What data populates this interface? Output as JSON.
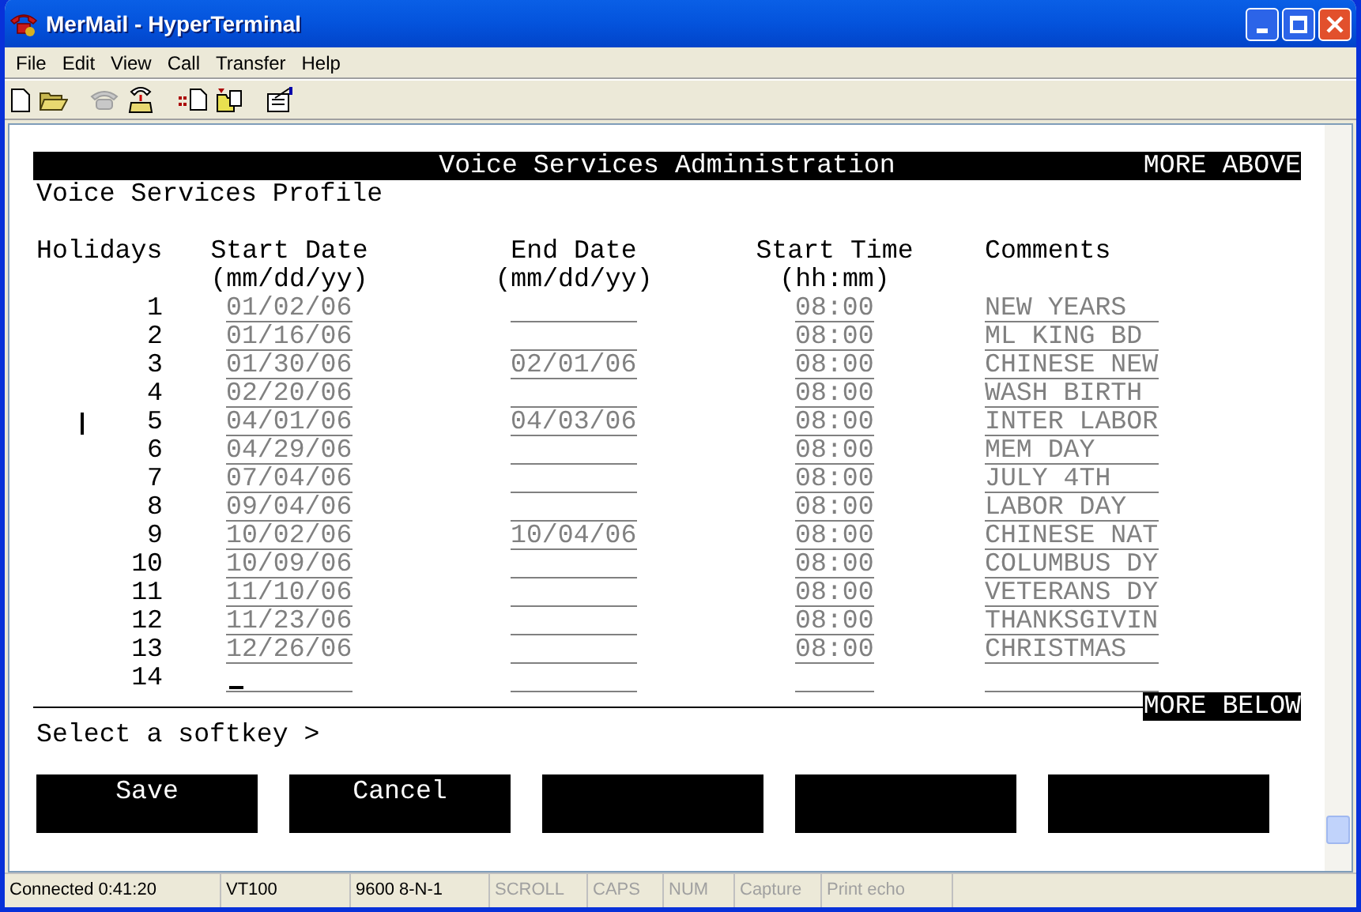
{
  "window": {
    "title": "MerMail - HyperTerminal"
  },
  "menu": [
    "File",
    "Edit",
    "View",
    "Call",
    "Transfer",
    "Help"
  ],
  "terminal": {
    "banner_title": "Voice Services Administration",
    "banner_right": "MORE ABOVE",
    "profile_title": "Voice Services Profile",
    "columns": [
      {
        "label": "Holidays"
      },
      {
        "label": "Start Date",
        "sublabel": "(mm/dd/yy)"
      },
      {
        "label": "End Date",
        "sublabel": "(mm/dd/yy)"
      },
      {
        "label": "Start Time",
        "sublabel": "(hh:mm)"
      },
      {
        "label": "Comments"
      }
    ],
    "rows": [
      {
        "number": "1",
        "start_date": "01/02/06",
        "start_time": "08:00",
        "comment": "NEW YEARS",
        "pointer": false,
        "cursor": false
      },
      {
        "number": "2",
        "start_date": "01/16/06",
        "start_time": "08:00",
        "comment": "ML KING BD",
        "pointer": false,
        "cursor": false
      },
      {
        "number": "3",
        "start_date": "01/30/06",
        "end_date": "02/01/06",
        "start_time": "08:00",
        "comment": "CHINESE NEW",
        "pointer": false,
        "cursor": false
      },
      {
        "number": "4",
        "start_date": "02/20/06",
        "start_time": "08:00",
        "comment": "WASH BIRTH",
        "pointer": false,
        "cursor": false
      },
      {
        "number": "5",
        "start_date": "04/01/06",
        "end_date": "04/03/06",
        "start_time": "08:00",
        "comment": "INTER LABOR",
        "pointer": true,
        "cursor": false
      },
      {
        "number": "6",
        "start_date": "04/29/06",
        "start_time": "08:00",
        "comment": "MEM DAY",
        "pointer": false,
        "cursor": false
      },
      {
        "number": "7",
        "start_date": "07/04/06",
        "start_time": "08:00",
        "comment": "JULY 4TH",
        "pointer": false,
        "cursor": false
      },
      {
        "number": "8",
        "start_date": "09/04/06",
        "start_time": "08:00",
        "comment": "LABOR DAY",
        "pointer": false,
        "cursor": false
      },
      {
        "number": "9",
        "start_date": "10/02/06",
        "end_date": "10/04/06",
        "start_time": "08:00",
        "comment": "CHINESE NAT",
        "pointer": false,
        "cursor": false
      },
      {
        "number": "10",
        "start_date": "10/09/06",
        "start_time": "08:00",
        "comment": "COLUMBUS DY",
        "pointer": false,
        "cursor": false
      },
      {
        "number": "11",
        "start_date": "11/10/06",
        "start_time": "08:00",
        "comment": "VETERANS DY",
        "pointer": false,
        "cursor": false
      },
      {
        "number": "12",
        "start_date": "11/23/06",
        "start_time": "08:00",
        "comment": "THANKSGIVIN",
        "pointer": false,
        "cursor": false
      },
      {
        "number": "13",
        "start_date": "12/26/06",
        "start_time": "08:00",
        "comment": "CHRISTMAS",
        "pointer": false,
        "cursor": false
      },
      {
        "number": "14",
        "pointer": false,
        "cursor": true
      }
    ],
    "more_below": "MORE BELOW",
    "prompt": "Select a softkey >",
    "softkeys": [
      {
        "kind": "labeled",
        "label": "Save"
      },
      {
        "kind": "labeled",
        "label": "Cancel"
      },
      {
        "kind": "blank"
      },
      {
        "kind": "blank"
      },
      {
        "kind": "blank"
      }
    ]
  },
  "status_bar": [
    {
      "text": "Connected 0:41:20",
      "disabled": false
    },
    {
      "text": "VT100",
      "disabled": false
    },
    {
      "text": "9600 8-N-1",
      "disabled": false
    },
    {
      "text": "SCROLL",
      "disabled": true
    },
    {
      "text": "CAPS",
      "disabled": true
    },
    {
      "text": "NUM",
      "disabled": true
    },
    {
      "text": "Capture",
      "disabled": true
    },
    {
      "text": "Print echo",
      "disabled": true
    }
  ]
}
